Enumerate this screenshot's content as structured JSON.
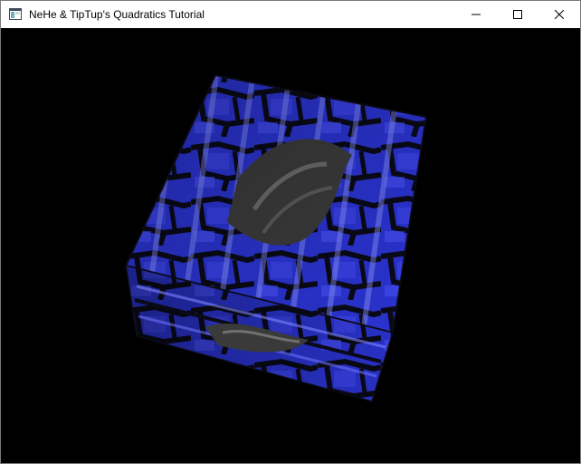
{
  "window": {
    "title": "NeHe & TipTup's Quadratics Tutorial",
    "icon": "application-window-icon"
  },
  "caption_buttons": {
    "minimize": "minimize-icon",
    "maximize": "maximize-icon",
    "close": "close-icon"
  },
  "scene": {
    "description_object": "textured-rotating-cube",
    "texture_colors": {
      "stone_blue": "#2b35d6",
      "stone_light": "#6a73ff",
      "mortar": "#0a0a14",
      "center_stone": "#3a3a3a"
    }
  }
}
